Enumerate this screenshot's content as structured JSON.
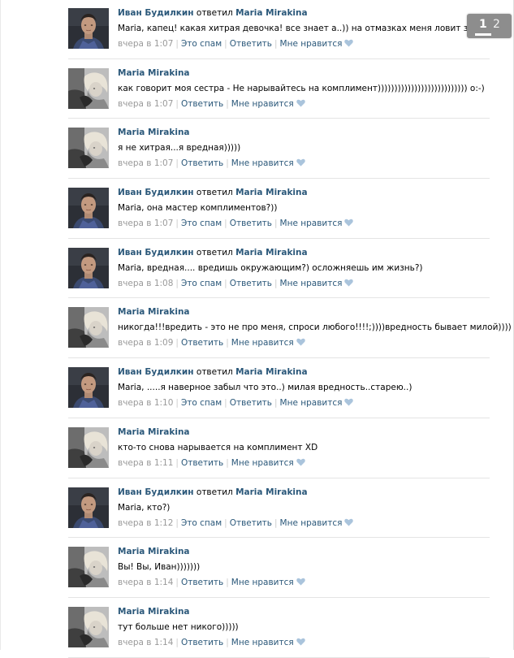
{
  "pager": {
    "pages": [
      "1",
      "2"
    ],
    "current": "1"
  },
  "comments": [
    {
      "avatar": "ivan",
      "author": "Иван Будилкин",
      "replied": "ответил",
      "reply_to": "Maria Mirakina",
      "text": "Maria, капец! какая хитрая девочка! все знает а..)) на отмазках меня ловит значит...",
      "time": "вчера в 1:07",
      "spam": "Это спам",
      "reply": "Ответить",
      "like": "Мне нравится"
    },
    {
      "avatar": "maria",
      "author": "Maria Mirakina",
      "text": "как говорит моя сестра - Не нарывайтесь на комплимент))))))))))))))))))))))))))) о:-)",
      "time": "вчера в 1:07",
      "reply": "Ответить",
      "like": "Мне нравится"
    },
    {
      "avatar": "maria",
      "author": "Maria Mirakina",
      "text": "я не хитрая...я вредная)))))",
      "time": "вчера в 1:07",
      "reply": "Ответить",
      "like": "Мне нравится"
    },
    {
      "avatar": "ivan",
      "author": "Иван Будилкин",
      "replied": "ответил",
      "reply_to": "Maria Mirakina",
      "text": "Maria, она мастер комплиментов?))",
      "time": "вчера в 1:07",
      "spam": "Это спам",
      "reply": "Ответить",
      "like": "Мне нравится"
    },
    {
      "avatar": "ivan",
      "author": "Иван Будилкин",
      "replied": "ответил",
      "reply_to": "Maria Mirakina",
      "text": "Maria, вредная.... вредишь окружающим?) осложняешь им жизнь?)",
      "time": "вчера в 1:08",
      "spam": "Это спам",
      "reply": "Ответить",
      "like": "Мне нравится"
    },
    {
      "avatar": "maria",
      "author": "Maria Mirakina",
      "text": "никогда!!!вредить - это не про меня, спроси любого!!!!;))))вредность бывает милой))))",
      "time": "вчера в 1:09",
      "reply": "Ответить",
      "like": "Мне нравится"
    },
    {
      "avatar": "ivan",
      "author": "Иван Будилкин",
      "replied": "ответил",
      "reply_to": "Maria Mirakina",
      "text": "Maria, .....я наверное забыл что это..) милая вредность..старею..)",
      "time": "вчера в 1:10",
      "spam": "Это спам",
      "reply": "Ответить",
      "like": "Мне нравится"
    },
    {
      "avatar": "maria",
      "author": "Maria Mirakina",
      "text": "кто-то снова нарывается на комплимент XD",
      "time": "вчера в 1:11",
      "reply": "Ответить",
      "like": "Мне нравится"
    },
    {
      "avatar": "ivan",
      "author": "Иван Будилкин",
      "replied": "ответил",
      "reply_to": "Maria Mirakina",
      "text": "Maria, кто?)",
      "time": "вчера в 1:12",
      "spam": "Это спам",
      "reply": "Ответить",
      "like": "Мне нравится"
    },
    {
      "avatar": "maria",
      "author": "Maria Mirakina",
      "text": "Вы! Вы, Иван)))))))",
      "time": "вчера в 1:14",
      "reply": "Ответить",
      "like": "Мне нравится"
    },
    {
      "avatar": "maria",
      "author": "Maria Mirakina",
      "text": "тут больше нет никого)))))",
      "time": "вчера в 1:14",
      "reply": "Ответить",
      "like": "Мне нравится"
    }
  ],
  "colors": {
    "link": "#2b587a",
    "meta": "#999999",
    "heart": "#aac4dc",
    "pager_bg": "#8d8d8d"
  }
}
